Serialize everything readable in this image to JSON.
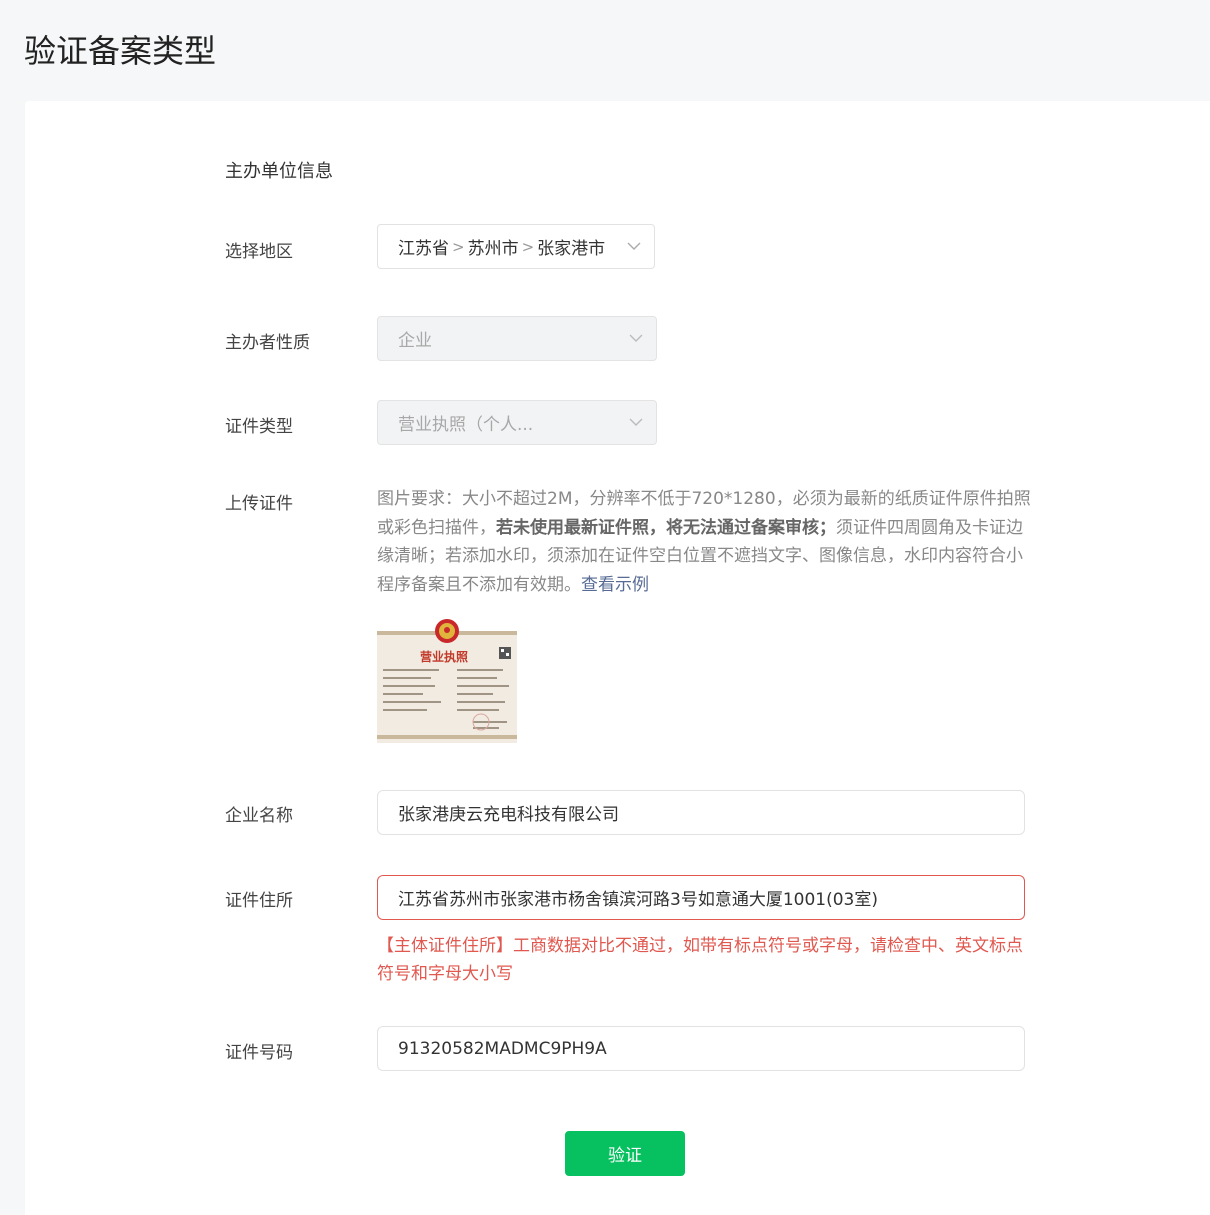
{
  "page": {
    "title": "验证备案类型"
  },
  "form": {
    "section_title": "主办单位信息",
    "region": {
      "label": "选择地区",
      "province": "江苏省",
      "city": "苏州市",
      "district": "张家港市",
      "separator": ">"
    },
    "organizer_type": {
      "label": "主办者性质",
      "value": "企业"
    },
    "certificate_type": {
      "label": "证件类型",
      "value": "营业执照（个人..."
    },
    "upload": {
      "label": "上传证件",
      "desc_part1": "图片要求：大小不超过2M，分辨率不低于720*1280，必须为最新的纸质证件原件拍照或彩色扫描件，",
      "desc_bold": "若未使用最新证件照，将无法通过备案审核；",
      "desc_part2": "须证件四周圆角及卡证边缘清晰；若添加水印，须添加在证件空白位置不遮挡文字、图像信息，水印内容符合小程序备案且不添加有效期。",
      "example_link": "查看示例",
      "license_heading": "营业执照"
    },
    "company_name": {
      "label": "企业名称",
      "value": "张家港庚云充电科技有限公司"
    },
    "address": {
      "label": "证件住所",
      "value": "江苏省苏州市张家港市杨舍镇滨河路3号如意通大厦1001(03室)",
      "error": "【主体证件住所】工商数据对比不通过，如带有标点符号或字母，请检查中、英文标点符号和字母大小写"
    },
    "certificate_number": {
      "label": "证件号码",
      "value": "91320582MADMC9PH9A"
    },
    "submit_label": "验证"
  },
  "colors": {
    "primary": "#07c160",
    "error": "#e0584f",
    "link": "#576b95"
  }
}
